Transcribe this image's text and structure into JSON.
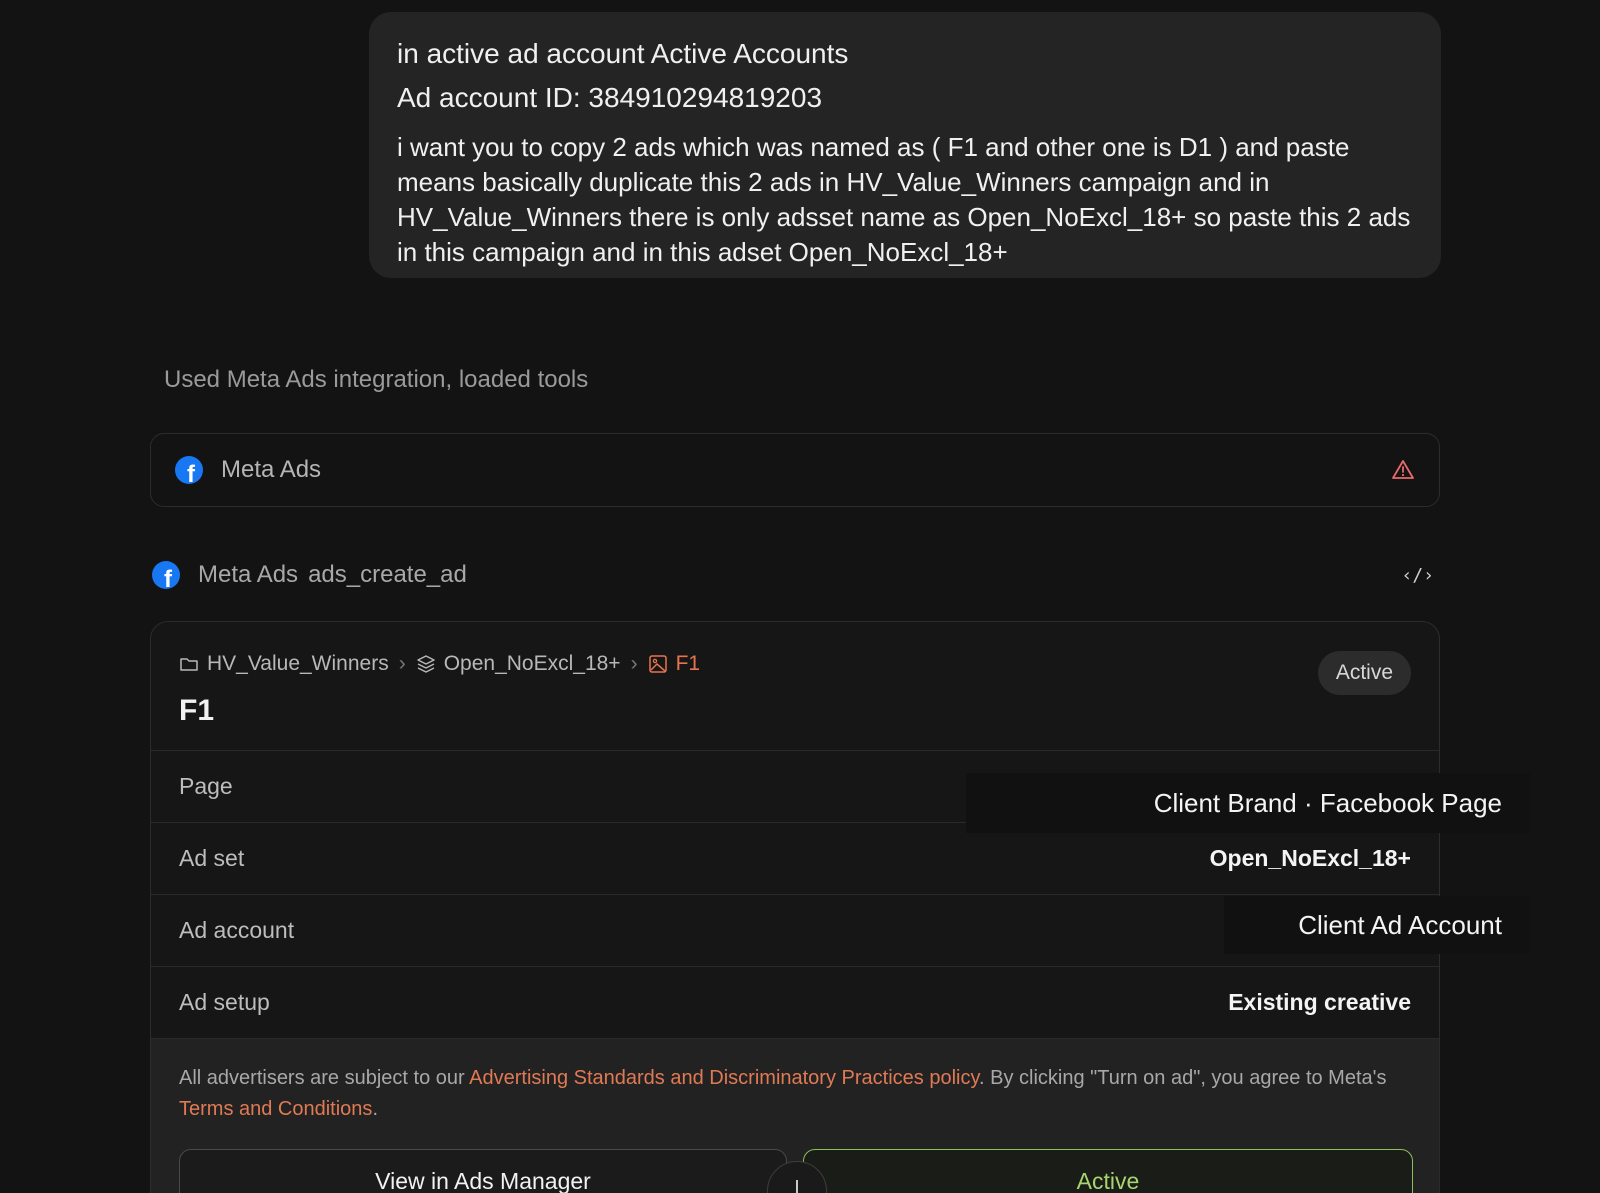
{
  "user_message": {
    "line1": "in active ad account Active Accounts",
    "line2": "Ad account ID: 384910294819203",
    "body": "i want you to copy 2 ads which was named as ( F1 and other one is D1 ) and paste means basically duplicate this 2 ads in HV_Value_Winners campaign and in HV_Value_Winners there is only  adsset name as Open_NoExcl_18+ so paste this 2 ads in this campaign and in this adset Open_NoExcl_18+"
  },
  "tool_status": "Used Meta Ads integration, loaded tools",
  "integration": {
    "name": "Meta Ads",
    "icon": "facebook-icon",
    "status_icon": "warning-triangle-icon"
  },
  "tool_call": {
    "integration": "Meta Ads",
    "function": "ads_create_ad",
    "code_icon": "code-brackets-icon"
  },
  "ad_card": {
    "breadcrumb": {
      "campaign": "HV_Value_Winners",
      "adset": "Open_NoExcl_18+",
      "ad": "F1",
      "separator": "›"
    },
    "title": "F1",
    "status": "Active",
    "rows": [
      {
        "label": "Page",
        "value": "Client Brand · Facebook Page"
      },
      {
        "label": "Ad set",
        "value": "Open_NoExcl_18+"
      },
      {
        "label": "Ad account",
        "value": "Client Ad Account"
      },
      {
        "label": "Ad setup",
        "value": "Existing creative"
      }
    ],
    "legal": {
      "prefix": "All advertisers are subject to our ",
      "policy_link": "Advertising Standards and Discriminatory Practices policy",
      "middle": ". By clicking \"Turn on ad\", you agree to Meta's ",
      "terms_link": "Terms and Conditions",
      "suffix": "."
    },
    "buttons": {
      "view": "View in Ads Manager",
      "active": "Active",
      "round_glyph": "|"
    }
  },
  "colors": {
    "background": "#131313",
    "bubble": "#242424",
    "link": "#e07a55",
    "active_green": "#a8d46f",
    "facebook_blue": "#1877f2",
    "warning": "#e86a6a"
  }
}
